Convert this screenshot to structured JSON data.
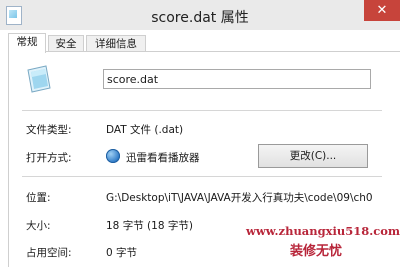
{
  "window": {
    "title": "score.dat 属性",
    "close_glyph": "✕",
    "icon": "properties-doc-icon"
  },
  "tabs": [
    {
      "label": "常规",
      "active": true
    },
    {
      "label": "安全",
      "active": false
    },
    {
      "label": "详细信息",
      "active": false
    }
  ],
  "file": {
    "icon": "file-icon",
    "name": "score.dat"
  },
  "properties": {
    "type_label": "文件类型:",
    "type_value": "DAT 文件 (.dat)",
    "opens_with_label": "打开方式:",
    "opens_with_value": "迅雷看看播放器",
    "opens_with_icon": "xunlei-player-icon",
    "change_button": "更改(C)...",
    "location_label": "位置:",
    "location_value": "G:\\Desktop\\iT\\JAVA\\JAVA开发入行真功夫\\code\\09\\ch0",
    "size_label": "大小:",
    "size_value": "18 字节 (18 字节)",
    "size_on_disk_label": "占用空间:",
    "size_on_disk_value": "0 字节"
  },
  "watermark": {
    "url": "www.zhuangxiu518.com",
    "text": "装修无忧"
  },
  "colors": {
    "titlebar": "#eaeaea",
    "close_button": "#c7443b",
    "watermark": "#b8263a"
  }
}
